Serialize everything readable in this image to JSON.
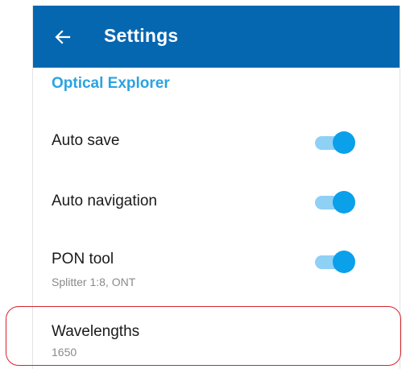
{
  "header": {
    "title": "Settings",
    "back_icon": "arrow-left-icon",
    "background": "#0667b1"
  },
  "section": {
    "title": "Optical Explorer",
    "color": "#2ba3e1"
  },
  "settings": {
    "auto_save": {
      "label": "Auto save",
      "enabled": true
    },
    "auto_navigation": {
      "label": "Auto navigation",
      "enabled": true
    },
    "pon_tool": {
      "label": "PON tool",
      "subtitle": "Splitter 1:8, ONT",
      "enabled": true
    },
    "wavelengths": {
      "label": "Wavelengths",
      "value": "1650"
    }
  },
  "colors": {
    "toggle_thumb": "#0aa0ea",
    "toggle_track": "#8fd0f5",
    "highlight": "#d9232a"
  }
}
